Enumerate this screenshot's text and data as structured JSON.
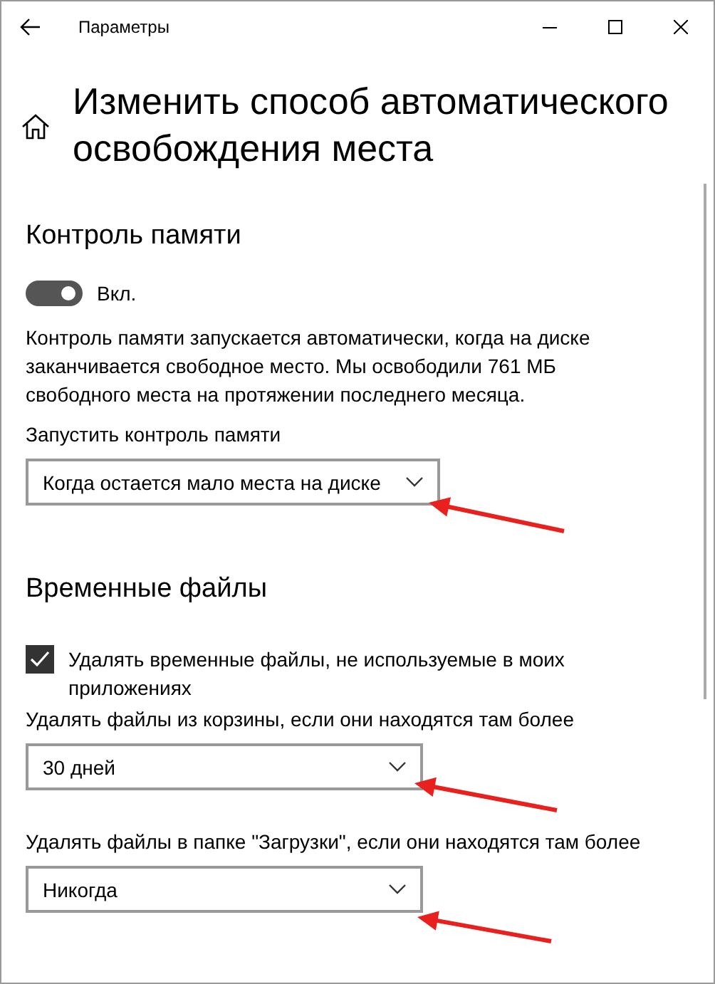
{
  "window": {
    "title": "Параметры"
  },
  "page_title": "Изменить способ автоматического освобождения места",
  "storage_sense": {
    "heading": "Контроль памяти",
    "toggle": {
      "on": true,
      "label": "Вкл."
    },
    "description": "Контроль памяти запускается автоматически, когда на диске заканчивается свободное место. Мы освободили 761 МБ свободного места на протяжении последнего месяца.",
    "run_label": "Запустить контроль памяти",
    "run_value": "Когда остается мало места на диске"
  },
  "temp_files": {
    "heading": "Временные файлы",
    "checkbox": {
      "label": "Удалять временные файлы, не используемые в моих приложениях",
      "checked": true
    },
    "recycle_label": "Удалять файлы из корзины, если они находятся там более",
    "recycle_value": "30 дней",
    "downloads_label": "Удалять файлы в папке \"Загрузки\", если они находятся там более",
    "downloads_value": "Никогда"
  }
}
